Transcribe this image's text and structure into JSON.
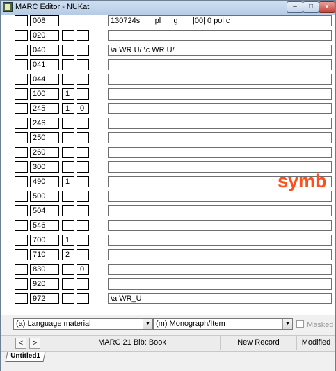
{
  "window": {
    "title": "MARC Editor - NUKat",
    "controls": {
      "min": "–",
      "max": "□",
      "close": "x"
    }
  },
  "fields": [
    {
      "tag": "008",
      "ind1": "",
      "ind2": "",
      "value": "130724s       pl      g       |00| 0 pol c",
      "fixed": true
    },
    {
      "tag": "020",
      "ind1": "",
      "ind2": "",
      "value": ""
    },
    {
      "tag": "040",
      "ind1": "",
      "ind2": "",
      "value": "\\a WR U/ \\c WR U/"
    },
    {
      "tag": "041",
      "ind1": "",
      "ind2": "",
      "value": ""
    },
    {
      "tag": "044",
      "ind1": "",
      "ind2": "",
      "value": ""
    },
    {
      "tag": "100",
      "ind1": "1",
      "ind2": "",
      "value": ""
    },
    {
      "tag": "245",
      "ind1": "1",
      "ind2": "0",
      "value": ""
    },
    {
      "tag": "246",
      "ind1": "",
      "ind2": "",
      "value": ""
    },
    {
      "tag": "250",
      "ind1": "",
      "ind2": "",
      "value": ""
    },
    {
      "tag": "260",
      "ind1": "",
      "ind2": "",
      "value": ""
    },
    {
      "tag": "300",
      "ind1": "",
      "ind2": "",
      "value": ""
    },
    {
      "tag": "490",
      "ind1": "1",
      "ind2": "",
      "value": ""
    },
    {
      "tag": "500",
      "ind1": "",
      "ind2": "",
      "value": ""
    },
    {
      "tag": "504",
      "ind1": "",
      "ind2": "",
      "value": ""
    },
    {
      "tag": "546",
      "ind1": "",
      "ind2": "",
      "value": ""
    },
    {
      "tag": "700",
      "ind1": "1",
      "ind2": "",
      "value": ""
    },
    {
      "tag": "710",
      "ind1": "2",
      "ind2": "",
      "value": ""
    },
    {
      "tag": "830",
      "ind1": "",
      "ind2": "0",
      "value": ""
    },
    {
      "tag": "920",
      "ind1": "",
      "ind2": "",
      "value": ""
    },
    {
      "tag": "972",
      "ind1": "",
      "ind2": "",
      "value": "\\a WR_U"
    }
  ],
  "overlay_text": "symb",
  "record_type": {
    "type_of_record": "(a) Language material",
    "bibliographic_level": "(m) Monograph/Item",
    "masked_label": "Masked",
    "masked_checked": false
  },
  "status": {
    "prev": "<",
    "next": ">",
    "format": "MARC 21 Bib: Book",
    "record_state": "New Record",
    "edit_state": "Modified"
  },
  "tabs": [
    {
      "label": "Untitled1"
    }
  ],
  "colors": {
    "overlay_accent": "#ff4f1a",
    "titlebar": "#b6cbe4",
    "close_button": "#c8463a"
  }
}
